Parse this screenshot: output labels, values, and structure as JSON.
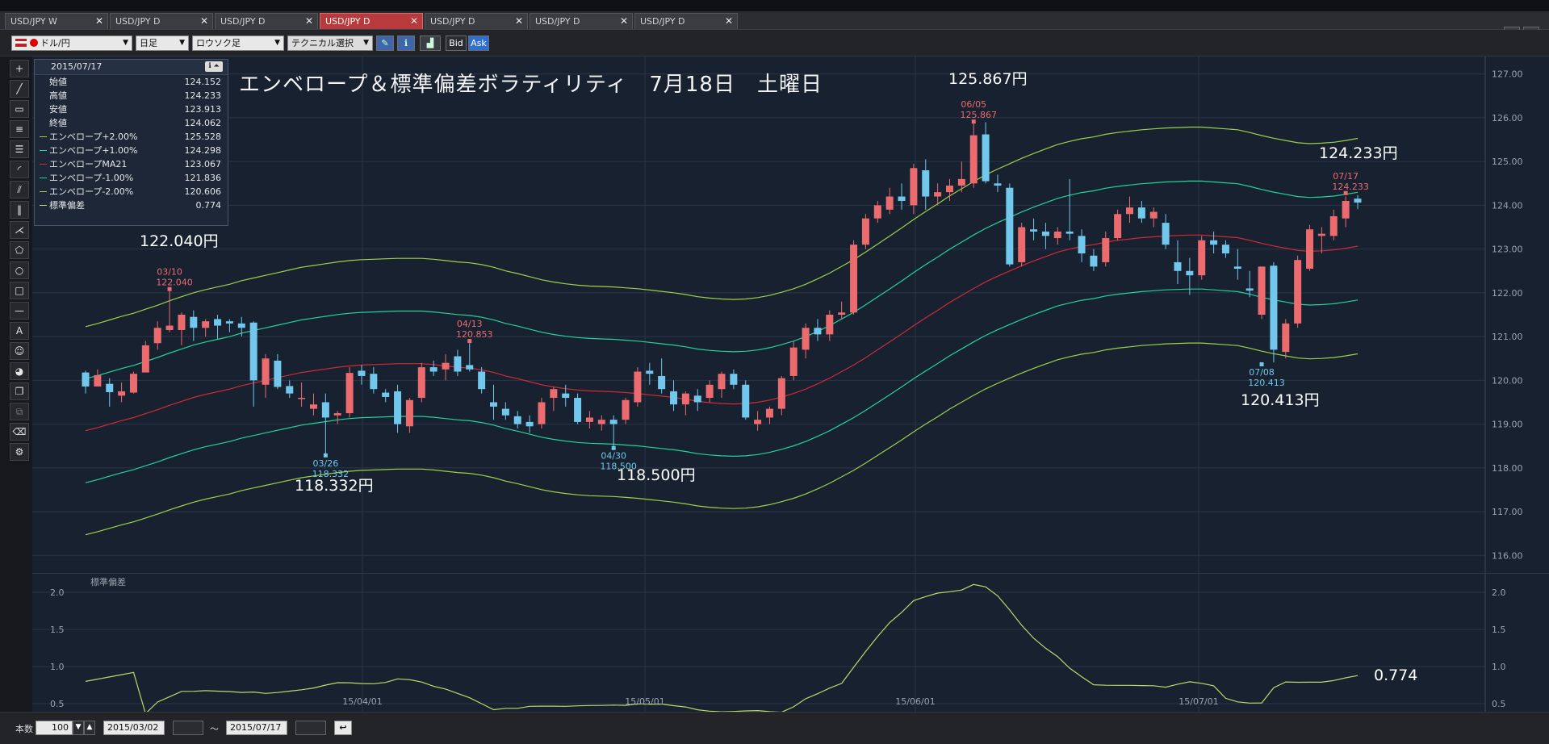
{
  "tabs": [
    {
      "label": "USD/JPY W",
      "active": false
    },
    {
      "label": "USD/JPY D",
      "active": false
    },
    {
      "label": "USD/JPY D",
      "active": false
    },
    {
      "label": "USD/JPY D",
      "active": true
    },
    {
      "label": "USD/JPY D",
      "active": false
    },
    {
      "label": "USD/JPY D",
      "active": false
    },
    {
      "label": "USD/JPY D",
      "active": false
    }
  ],
  "toolbar": {
    "pair_label": "ドル/円",
    "period_label": "日足",
    "chart_type_label": "ロウソク足",
    "tech_select_label": "テクニカル選択",
    "bid_label": "Bid",
    "ask_label": "Ask"
  },
  "info_panel": {
    "date": "2015/07/17",
    "rows": [
      {
        "label": "始値",
        "value": "124.152"
      },
      {
        "label": "高値",
        "value": "124.233"
      },
      {
        "label": "安値",
        "value": "123.913"
      },
      {
        "label": "終値",
        "value": "124.062"
      },
      {
        "label": "エンベロープ+2.00%",
        "value": "125.528",
        "color": "#9bd24a"
      },
      {
        "label": "エンベロープ+1.00%",
        "value": "124.298",
        "color": "#23d39b"
      },
      {
        "label": "エンベロープMA21",
        "value": "123.067",
        "color": "#d02a35"
      },
      {
        "label": "エンベロープ-1.00%",
        "value": "121.836",
        "color": "#23d39b"
      },
      {
        "label": "エンベロープ-2.00%",
        "value": "120.606",
        "color": "#9bd24a"
      },
      {
        "label": "標準偏差",
        "value": "0.774",
        "color": "#bfd86a"
      }
    ]
  },
  "headline": "エンベロープ＆標準偏差ボラティリティ　7月18日　土曜日",
  "big_annotations": [
    {
      "text": "122.040円"
    },
    {
      "text": "125.867円"
    },
    {
      "text": "124.233円"
    },
    {
      "text": "118.332円"
    },
    {
      "text": "118.500円"
    },
    {
      "text": "120.413円"
    },
    {
      "text": "0.774"
    }
  ],
  "point_labels": [
    {
      "date": "03/10",
      "price": "122.040",
      "kind": "high"
    },
    {
      "date": "04/13",
      "price": "120.853",
      "kind": "high"
    },
    {
      "date": "06/05",
      "price": "125.867",
      "kind": "high"
    },
    {
      "date": "07/17",
      "price": "124.233",
      "kind": "high"
    },
    {
      "date": "03/26",
      "price": "118.332",
      "kind": "low"
    },
    {
      "date": "04/30",
      "price": "118.500",
      "kind": "low"
    },
    {
      "date": "07/08",
      "price": "120.413",
      "kind": "low"
    }
  ],
  "main_axis": {
    "ticks": [
      "127.00",
      "126.00",
      "125.00",
      "124.00",
      "123.00",
      "122.00",
      "121.00",
      "120.00",
      "119.00",
      "118.00",
      "117.00",
      "116.00"
    ],
    "min": 115.6,
    "max": 127.4
  },
  "sub_axis": {
    "label": "標準偏差",
    "ticks": [
      "2.0",
      "1.5",
      "1.0",
      "0.5"
    ],
    "min": 0.38,
    "max": 2.25
  },
  "date_labels": [
    "15/04/01",
    "15/05/01",
    "15/06/01",
    "15/07/01"
  ],
  "candles": [
    [
      120.18,
      120.22,
      119.7,
      119.86
    ],
    [
      119.86,
      120.25,
      119.9,
      120.12
    ],
    [
      119.92,
      120.05,
      119.4,
      119.73
    ],
    [
      119.65,
      119.95,
      119.5,
      119.75
    ],
    [
      119.72,
      120.2,
      119.7,
      120.15
    ],
    [
      120.18,
      120.9,
      120.2,
      120.8
    ],
    [
      120.85,
      121.35,
      120.7,
      121.2
    ],
    [
      121.15,
      122.04,
      121.1,
      121.25
    ],
    [
      121.15,
      121.55,
      120.8,
      121.5
    ],
    [
      121.45,
      121.6,
      120.9,
      121.2
    ],
    [
      121.2,
      121.4,
      121.0,
      121.35
    ],
    [
      121.4,
      121.5,
      120.95,
      121.25
    ],
    [
      121.35,
      121.4,
      121.1,
      121.3
    ],
    [
      121.3,
      121.45,
      121.0,
      121.2
    ],
    [
      121.32,
      121.35,
      119.4,
      120.0
    ],
    [
      119.9,
      120.6,
      119.6,
      120.5
    ],
    [
      120.45,
      120.6,
      119.8,
      119.85
    ],
    [
      119.87,
      120.0,
      119.6,
      119.7
    ],
    [
      119.6,
      119.95,
      119.4,
      119.6
    ],
    [
      119.35,
      119.7,
      119.2,
      119.45
    ],
    [
      119.5,
      119.7,
      118.33,
      119.15
    ],
    [
      119.2,
      119.3,
      119.0,
      119.25
    ],
    [
      119.25,
      120.3,
      119.15,
      120.17
    ],
    [
      120.22,
      120.35,
      119.9,
      120.1
    ],
    [
      120.15,
      120.3,
      119.7,
      119.8
    ],
    [
      119.72,
      119.8,
      119.5,
      119.62
    ],
    [
      119.75,
      119.9,
      118.8,
      119.0
    ],
    [
      118.95,
      119.6,
      118.8,
      119.55
    ],
    [
      119.6,
      120.4,
      119.5,
      120.3
    ],
    [
      120.3,
      120.45,
      120.1,
      120.2
    ],
    [
      120.25,
      120.6,
      120.0,
      120.4
    ],
    [
      120.55,
      120.7,
      120.1,
      120.2
    ],
    [
      120.35,
      120.85,
      120.2,
      120.25
    ],
    [
      120.2,
      120.3,
      119.7,
      119.8
    ],
    [
      119.5,
      119.9,
      119.1,
      119.4
    ],
    [
      119.35,
      119.5,
      119.1,
      119.2
    ],
    [
      119.18,
      119.3,
      118.9,
      119.0
    ],
    [
      119.05,
      119.2,
      118.8,
      118.95
    ],
    [
      119.0,
      119.6,
      118.9,
      119.5
    ],
    [
      119.6,
      119.85,
      119.3,
      119.8
    ],
    [
      119.7,
      119.9,
      119.4,
      119.6
    ],
    [
      119.6,
      119.7,
      119.0,
      119.05
    ],
    [
      119.05,
      119.3,
      118.9,
      119.15
    ],
    [
      119.0,
      119.2,
      118.85,
      119.1
    ],
    [
      119.1,
      119.2,
      118.5,
      119.0
    ],
    [
      119.1,
      119.6,
      119.0,
      119.55
    ],
    [
      119.5,
      120.3,
      119.4,
      120.2
    ],
    [
      120.22,
      120.4,
      119.9,
      120.15
    ],
    [
      120.1,
      120.5,
      119.7,
      119.8
    ],
    [
      119.75,
      120.0,
      119.3,
      119.45
    ],
    [
      119.45,
      119.75,
      119.2,
      119.7
    ],
    [
      119.65,
      119.8,
      119.3,
      119.5
    ],
    [
      119.6,
      120.0,
      119.5,
      119.9
    ],
    [
      119.8,
      120.2,
      119.6,
      120.15
    ],
    [
      120.15,
      120.25,
      119.8,
      119.9
    ],
    [
      119.9,
      120.0,
      119.1,
      119.15
    ],
    [
      119.0,
      119.3,
      118.85,
      119.1
    ],
    [
      119.15,
      119.4,
      119.0,
      119.35
    ],
    [
      119.35,
      120.1,
      119.2,
      120.05
    ],
    [
      120.1,
      120.9,
      120.0,
      120.75
    ],
    [
      120.7,
      121.3,
      120.5,
      121.2
    ],
    [
      121.2,
      121.4,
      120.9,
      121.05
    ],
    [
      121.05,
      121.6,
      120.9,
      121.5
    ],
    [
      121.5,
      121.8,
      121.4,
      121.55
    ],
    [
      121.55,
      123.2,
      121.5,
      123.1
    ],
    [
      123.1,
      123.8,
      123.0,
      123.7
    ],
    [
      123.7,
      124.1,
      123.6,
      124.0
    ],
    [
      123.9,
      124.4,
      123.8,
      124.2
    ],
    [
      124.2,
      124.5,
      123.9,
      124.1
    ],
    [
      124.0,
      124.95,
      123.8,
      124.85
    ],
    [
      124.8,
      125.05,
      123.9,
      124.2
    ],
    [
      124.2,
      124.5,
      124.0,
      124.3
    ],
    [
      124.3,
      124.6,
      124.1,
      124.45
    ],
    [
      124.45,
      125.0,
      124.3,
      124.6
    ],
    [
      124.5,
      125.867,
      124.4,
      125.6
    ],
    [
      125.62,
      125.9,
      124.5,
      124.55
    ],
    [
      124.5,
      124.7,
      124.3,
      124.45
    ],
    [
      124.4,
      124.5,
      122.6,
      122.65
    ],
    [
      122.7,
      123.6,
      122.6,
      123.5
    ],
    [
      123.45,
      123.7,
      123.2,
      123.4
    ],
    [
      123.4,
      123.6,
      123.0,
      123.3
    ],
    [
      123.25,
      123.5,
      123.1,
      123.4
    ],
    [
      123.4,
      124.6,
      123.2,
      123.35
    ],
    [
      123.3,
      123.45,
      122.7,
      122.9
    ],
    [
      122.85,
      123.0,
      122.5,
      122.6
    ],
    [
      122.7,
      123.4,
      122.6,
      123.25
    ],
    [
      123.25,
      123.9,
      123.2,
      123.8
    ],
    [
      123.8,
      124.2,
      123.6,
      123.95
    ],
    [
      123.95,
      124.1,
      123.6,
      123.7
    ],
    [
      123.7,
      123.95,
      123.5,
      123.85
    ],
    [
      123.6,
      123.8,
      123.0,
      123.1
    ],
    [
      122.7,
      123.2,
      122.2,
      122.5
    ],
    [
      122.5,
      122.8,
      121.95,
      122.4
    ],
    [
      122.4,
      123.3,
      122.3,
      123.2
    ],
    [
      123.2,
      123.4,
      122.9,
      123.1
    ],
    [
      123.1,
      123.2,
      122.8,
      122.9
    ],
    [
      122.6,
      123.0,
      122.3,
      122.55
    ],
    [
      122.1,
      122.5,
      121.9,
      122.05
    ],
    [
      121.5,
      122.6,
      121.4,
      122.6
    ],
    [
      122.62,
      122.7,
      120.41,
      120.7
    ],
    [
      120.65,
      121.4,
      120.5,
      121.3
    ],
    [
      121.3,
      122.85,
      121.2,
      122.75
    ],
    [
      122.55,
      123.55,
      122.5,
      123.45
    ],
    [
      123.3,
      123.5,
      122.9,
      123.35
    ],
    [
      123.3,
      123.9,
      123.2,
      123.75
    ],
    [
      123.7,
      124.2,
      123.5,
      124.1
    ],
    [
      124.152,
      124.233,
      123.913,
      124.062
    ]
  ],
  "envelope_ma21": [
    118.85,
    118.92,
    119.0,
    119.08,
    119.15,
    119.24,
    119.33,
    119.43,
    119.52,
    119.61,
    119.68,
    119.74,
    119.8,
    119.88,
    119.94,
    120.0,
    120.06,
    120.12,
    120.18,
    120.22,
    120.26,
    120.3,
    120.33,
    120.35,
    120.36,
    120.37,
    120.38,
    120.38,
    120.38,
    120.36,
    120.33,
    120.3,
    120.28,
    120.24,
    120.18,
    120.1,
    120.04,
    119.97,
    119.9,
    119.85,
    119.81,
    119.78,
    119.76,
    119.75,
    119.74,
    119.72,
    119.7,
    119.67,
    119.64,
    119.61,
    119.57,
    119.52,
    119.49,
    119.47,
    119.46,
    119.47,
    119.5,
    119.55,
    119.62,
    119.7,
    119.8,
    119.92,
    120.05,
    120.2,
    120.35,
    120.52,
    120.7,
    120.88,
    121.06,
    121.25,
    121.43,
    121.6,
    121.78,
    121.94,
    122.1,
    122.25,
    122.38,
    122.5,
    122.62,
    122.73,
    122.83,
    122.93,
    123.0,
    123.06,
    123.1,
    123.16,
    123.2,
    123.23,
    123.26,
    123.28,
    123.3,
    123.31,
    123.32,
    123.32,
    123.3,
    123.28,
    123.26,
    123.2,
    123.13,
    123.07,
    123.02,
    122.97,
    122.95,
    122.96,
    122.98,
    123.02,
    123.067
  ]
}
